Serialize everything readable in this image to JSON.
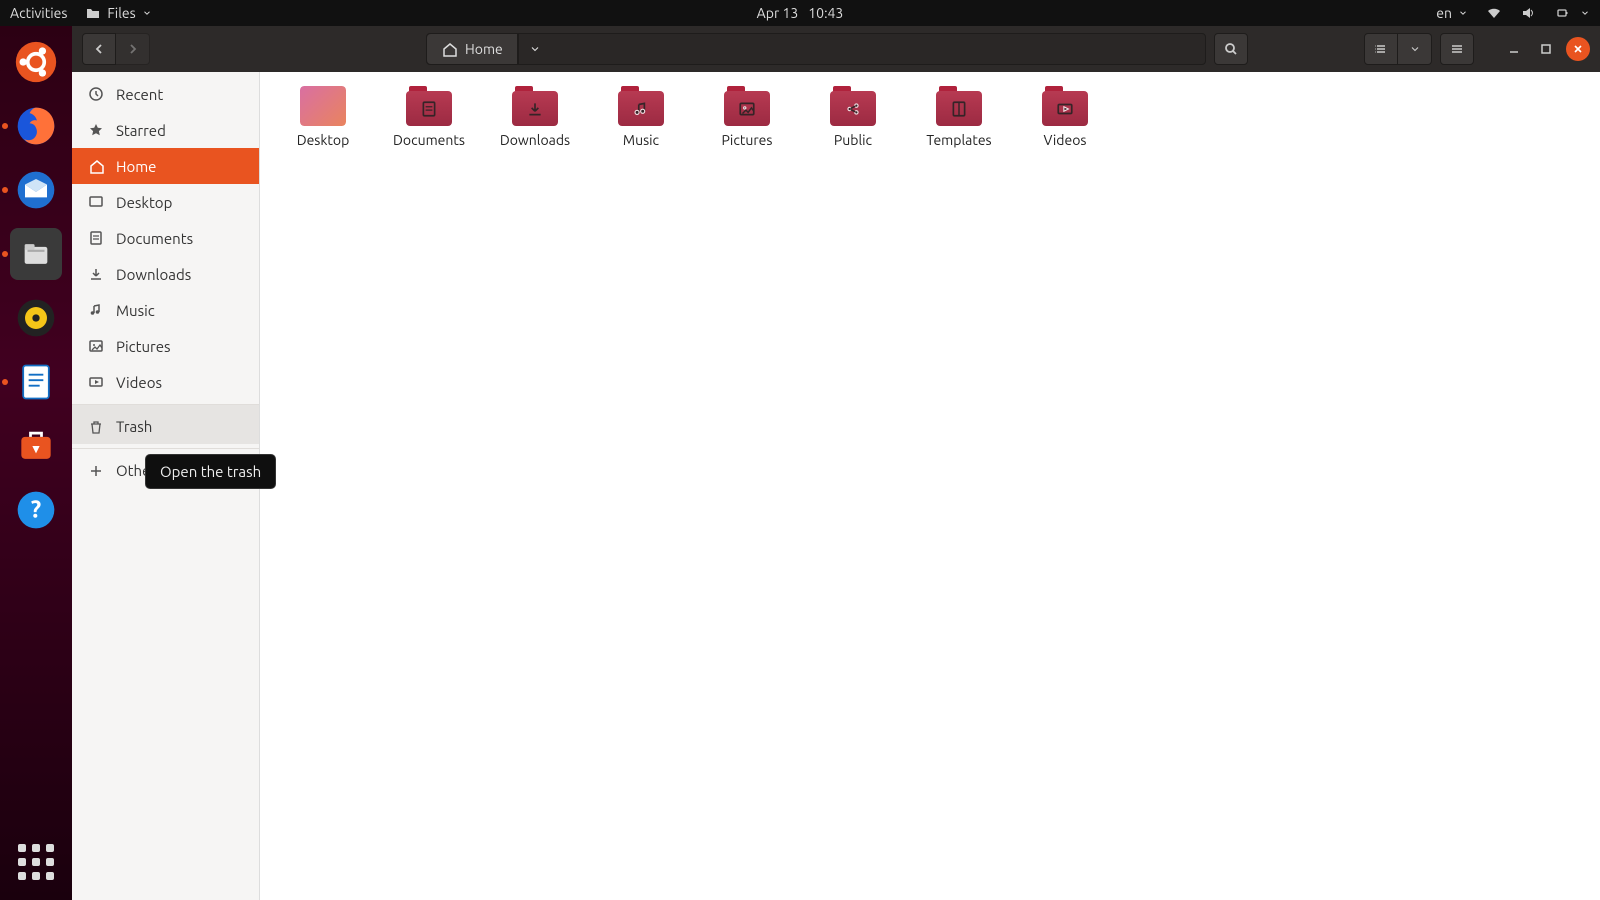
{
  "top_panel": {
    "activities": "Activities",
    "app_menu": "Files",
    "date": "Apr 13",
    "time": "10:43",
    "input_source": "en"
  },
  "dock": {
    "items": [
      "ubuntu",
      "firefox",
      "thunderbird",
      "files",
      "rhythmbox",
      "libreoffice-writer",
      "software",
      "help"
    ],
    "apps_button": "Show Applications"
  },
  "toolbar": {
    "location": "Home"
  },
  "sidebar": {
    "items": [
      {
        "label": "Recent",
        "icon": "clock"
      },
      {
        "label": "Starred",
        "icon": "star"
      },
      {
        "label": "Home",
        "icon": "home",
        "active": true
      },
      {
        "label": "Desktop",
        "icon": "desktop"
      },
      {
        "label": "Documents",
        "icon": "document"
      },
      {
        "label": "Downloads",
        "icon": "download"
      },
      {
        "label": "Music",
        "icon": "music"
      },
      {
        "label": "Pictures",
        "icon": "image"
      },
      {
        "label": "Videos",
        "icon": "video"
      },
      {
        "label": "Trash",
        "icon": "trash",
        "hover": true
      }
    ],
    "other": "Other Locations"
  },
  "folders": [
    {
      "label": "Desktop",
      "type": "desktop"
    },
    {
      "label": "Documents",
      "glyph": "document"
    },
    {
      "label": "Downloads",
      "glyph": "download"
    },
    {
      "label": "Music",
      "glyph": "music"
    },
    {
      "label": "Pictures",
      "glyph": "image"
    },
    {
      "label": "Public",
      "glyph": "share"
    },
    {
      "label": "Templates",
      "glyph": "template"
    },
    {
      "label": "Videos",
      "glyph": "video"
    }
  ],
  "tooltip": "Open the trash"
}
